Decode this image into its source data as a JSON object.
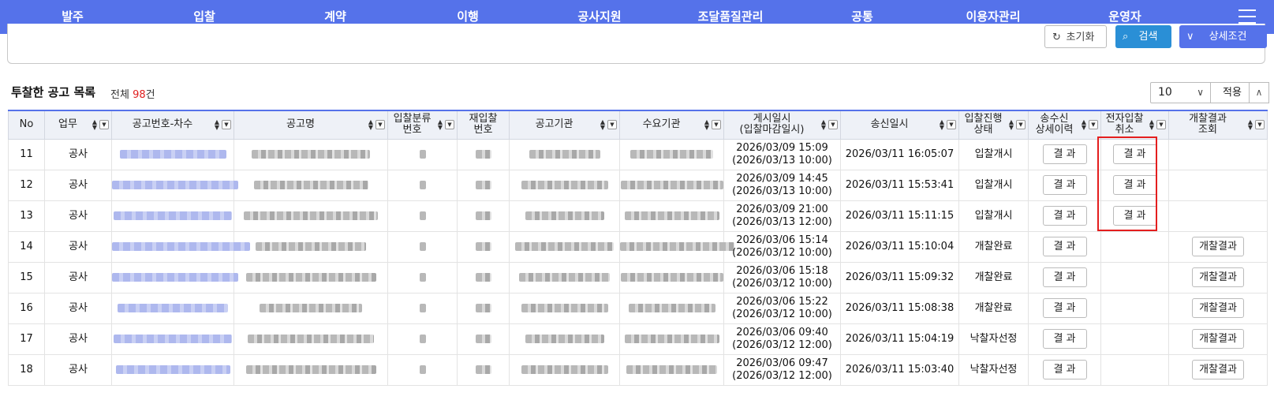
{
  "nav": {
    "items": [
      {
        "label": "발주"
      },
      {
        "label": "입찰"
      },
      {
        "label": "계약"
      },
      {
        "label": "이행"
      },
      {
        "label": "공사지원"
      },
      {
        "label": "조달품질관리"
      },
      {
        "label": "공통"
      },
      {
        "label": "이용자관리"
      },
      {
        "label": "운영자"
      }
    ],
    "menu_icon": "hamburger-menu-icon"
  },
  "search": {
    "reset_label": "초기화",
    "search_label": "검색",
    "detail_label": "상세조건"
  },
  "list": {
    "title": "투찰한 공고 목록",
    "count_prefix": "전체 ",
    "count": "98",
    "count_suffix": "건",
    "page_size": "10",
    "apply_label": "적용",
    "up_icon": "chevron-up-icon"
  },
  "table": {
    "columns": {
      "no": "No",
      "work": "업무",
      "notice_no": "공고번호-차수",
      "notice_name": "공고명",
      "bid_class_1": "입찰분류",
      "bid_class_2": "번호",
      "rebid_1": "재입찰",
      "rebid_2": "번호",
      "agency": "공고기관",
      "demand_agency": "수요기관",
      "posted_1": "게시일시",
      "posted_2": "(입찰마감일시)",
      "sent": "송신일시",
      "status_1": "입찰진행",
      "status_2": "상태",
      "history_1": "송수신",
      "history_2": "상세이력",
      "ecancel_1": "전자입찰",
      "ecancel_2": "취소",
      "open_1": "개찰결과",
      "open_2": "조회"
    },
    "rows": [
      {
        "no": "11",
        "work": "공사",
        "posted": "2026/03/09 15:09",
        "deadline": "(2026/03/13 10:00)",
        "sent": "2026/03/11 16:05:07",
        "status": "입찰개시",
        "history": "결 과",
        "ecancel": "결 과",
        "open": ""
      },
      {
        "no": "12",
        "work": "공사",
        "posted": "2026/03/09 14:45",
        "deadline": "(2026/03/13 10:00)",
        "sent": "2026/03/11 15:53:41",
        "status": "입찰개시",
        "history": "결 과",
        "ecancel": "결 과",
        "open": ""
      },
      {
        "no": "13",
        "work": "공사",
        "posted": "2026/03/09 21:00",
        "deadline": "(2026/03/13 12:00)",
        "sent": "2026/03/11 15:11:15",
        "status": "입찰개시",
        "history": "결 과",
        "ecancel": "결 과",
        "open": ""
      },
      {
        "no": "14",
        "work": "공사",
        "posted": "2026/03/06 15:14",
        "deadline": "(2026/03/12 10:00)",
        "sent": "2026/03/11 15:10:04",
        "status": "개찰완료",
        "history": "결 과",
        "ecancel": "",
        "open": "개찰결과"
      },
      {
        "no": "15",
        "work": "공사",
        "posted": "2026/03/06 15:18",
        "deadline": "(2026/03/12 10:00)",
        "sent": "2026/03/11 15:09:32",
        "status": "개찰완료",
        "history": "결 과",
        "ecancel": "",
        "open": "개찰결과"
      },
      {
        "no": "16",
        "work": "공사",
        "posted": "2026/03/06 15:22",
        "deadline": "(2026/03/12 10:00)",
        "sent": "2026/03/11 15:08:38",
        "status": "개찰완료",
        "history": "결 과",
        "ecancel": "",
        "open": "개찰결과"
      },
      {
        "no": "17",
        "work": "공사",
        "posted": "2026/03/06 09:40",
        "deadline": "(2026/03/12 12:00)",
        "sent": "2026/03/11 15:04:19",
        "status": "낙찰자선정",
        "history": "결 과",
        "ecancel": "",
        "open": "개찰결과"
      },
      {
        "no": "18",
        "work": "공사",
        "posted": "2026/03/06 09:47",
        "deadline": "(2026/03/12 12:00)",
        "sent": "2026/03/11 15:03:40",
        "status": "낙찰자선정",
        "history": "결 과",
        "ecancel": "",
        "open": "개찰결과"
      }
    ]
  },
  "colors": {
    "nav_bg": "#5572ea",
    "search_btn": "#2a8fd6",
    "count_red": "#e02020",
    "highlight": "#e41e1e"
  }
}
